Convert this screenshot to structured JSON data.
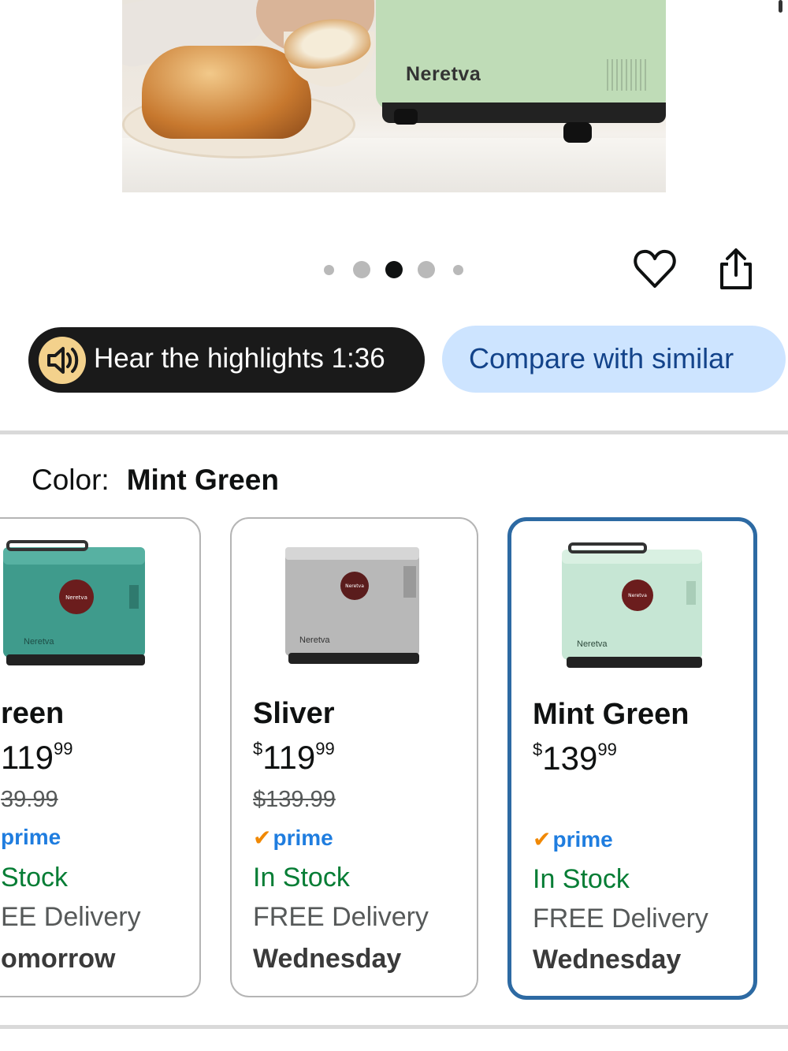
{
  "hero": {
    "brand": "Neretva",
    "image_label": "bread machine with loaf of bread"
  },
  "carousel": {
    "count": 5,
    "active_index": 2
  },
  "actions": {
    "favorite_icon": "heart-icon",
    "share_icon": "share-icon"
  },
  "highlights": {
    "label": "Hear the highlights 1:36",
    "icon": "speaker-icon"
  },
  "compare": {
    "label": "Compare with similar"
  },
  "color": {
    "label": "Color:",
    "selected": "Mint Green"
  },
  "variants": [
    {
      "name": "reen",
      "price_currency": "",
      "price_whole": "119",
      "price_cents": "99",
      "list_price": "39.99",
      "prime": "prime",
      "stock": " Stock",
      "delivery": "EE Delivery",
      "day": "omorrow",
      "machine_color": "#3f9b8c",
      "brand": "Neretva"
    },
    {
      "name": "Sliver",
      "price_currency": "$",
      "price_whole": "119",
      "price_cents": "99",
      "list_price": "$139.99",
      "prime": "prime",
      "stock": "In Stock",
      "delivery": "FREE Delivery",
      "day": "Wednesday",
      "machine_color": "#b8b8b8",
      "brand": "Neretva"
    },
    {
      "name": "Mint Green",
      "price_currency": "$",
      "price_whole": "139",
      "price_cents": "99",
      "list_price": "",
      "prime": "prime",
      "stock": "In Stock",
      "delivery": "FREE Delivery",
      "day": "Wednesday",
      "machine_color": "#c6e6d4",
      "brand": "Neretva"
    }
  ],
  "colors": {
    "prime_blue": "#1f7ddf",
    "stock_green": "#067d35",
    "selected_border": "#2d6aa3",
    "compare_bg": "#cde4ff"
  }
}
